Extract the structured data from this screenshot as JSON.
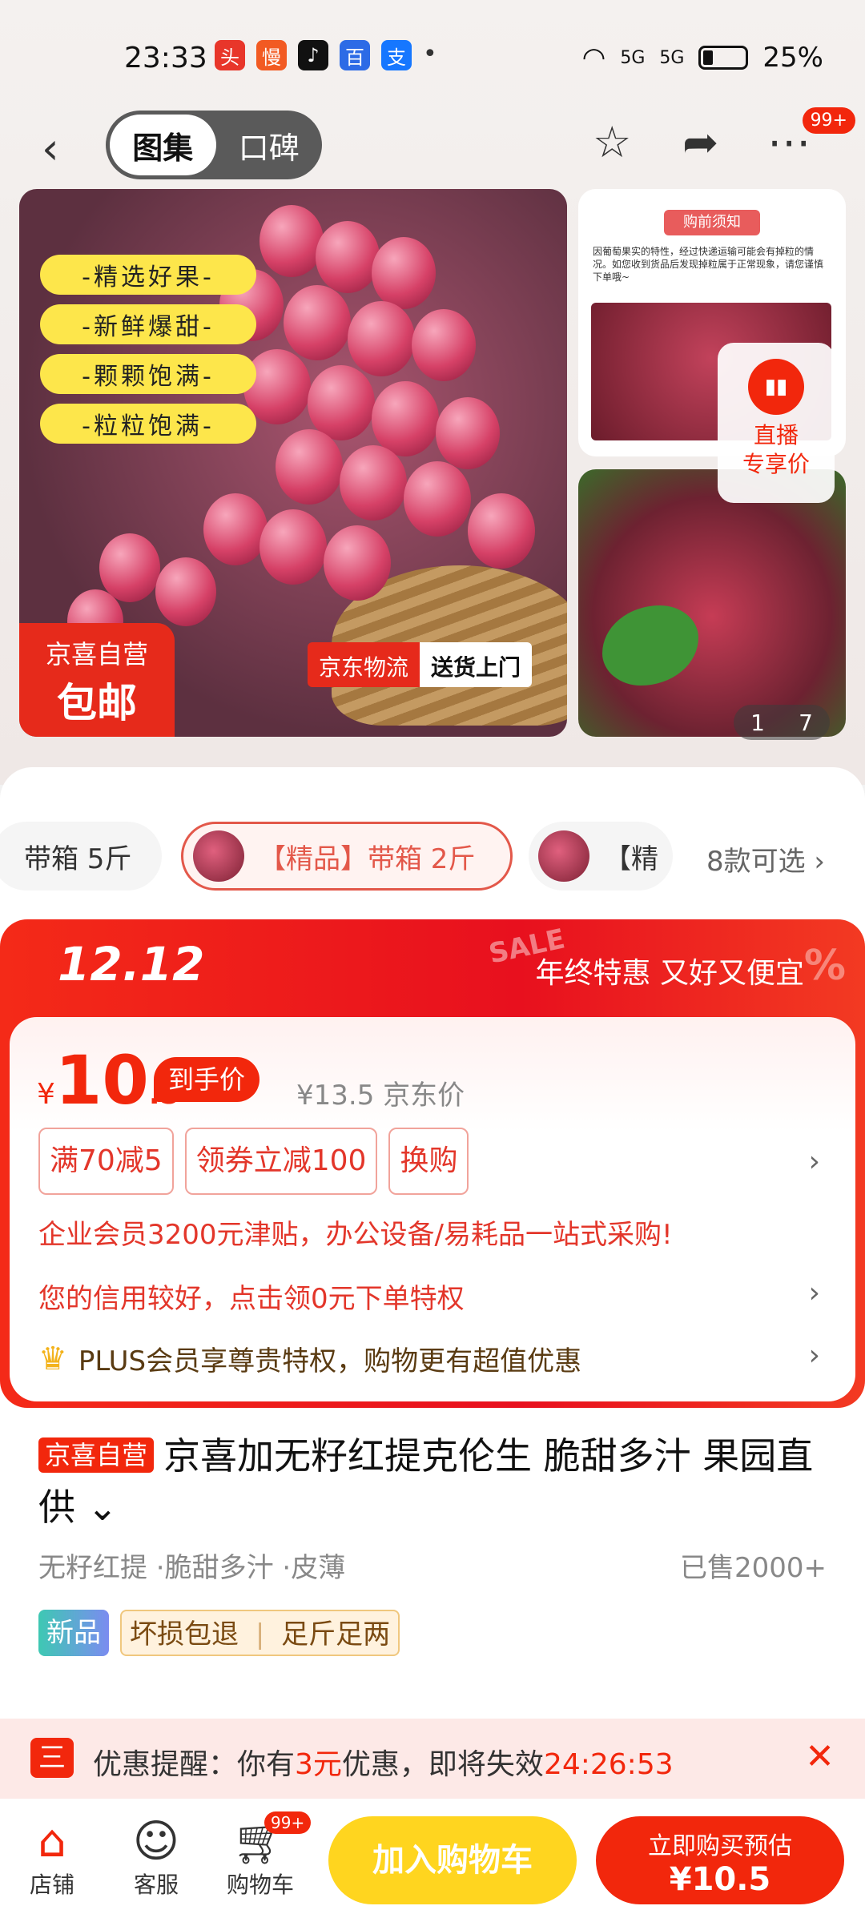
{
  "status": {
    "time": "23:33",
    "battery": "25%",
    "apps": [
      "头",
      "慢",
      "♪",
      "百",
      "支"
    ],
    "net1": "5G",
    "net2": "5G"
  },
  "nav": {
    "tab_gallery": "图集",
    "tab_reviews": "口碑",
    "badge": "99+"
  },
  "gallery": {
    "tags": [
      "-精选好果-",
      "-新鲜爆甜-",
      "-颗颗饱满-",
      "-粒粒饱满-"
    ],
    "self_op_line1": "京喜自营",
    "self_op_line2": "包邮",
    "logistics_a": "京东物流",
    "logistics_b": "送货上门",
    "notice_title": "购前须知",
    "notice_text": "因葡萄果实的特性，经过快递运输可能会有掉粒的情况。如您收到货品后发现掉粒属于正常现象，请您谨慎下单哦~",
    "live_line1": "直播",
    "live_line2": "专享价",
    "counter_current": "1",
    "counter_total": "7"
  },
  "specs": {
    "item1": "带箱 5斤",
    "item2": "【精品】带箱 2斤",
    "item3": "【精",
    "more": "8款可选 ›"
  },
  "promo": {
    "event": "12.12",
    "slogan": "年终特惠 又好又便宜",
    "sale": "SALE",
    "pct": "%",
    "currency": "¥",
    "price_int": "10",
    "price_dec": ".5",
    "price_tag": "到手价",
    "orig_price": "¥13.5 京东价",
    "coupons": [
      "满70减5",
      "领券立减100",
      "换购"
    ],
    "enterprise": "企业会员3200元津贴，办公设备/易耗品一站式采购!",
    "credit": "您的信用较好，点击领0元下单特权",
    "plus": "PLUS会员享尊贵特权，购物更有超值优惠"
  },
  "product": {
    "badge": "京喜自营",
    "title": "京喜加无籽红提克伦生 脆甜多汁 果园直供",
    "meta": "无籽红提 ·脆甜多汁 ·皮薄",
    "sold": "已售2000+",
    "tag_new": "新品",
    "tag_ship1": "坏损包退",
    "tag_ship2": "足斤足两"
  },
  "reminder": {
    "prefix": "优惠提醒：你有",
    "amount": "3元",
    "suffix": "优惠，即将失效",
    "countdown": "24:26:53"
  },
  "bottom": {
    "shop": "店铺",
    "service": "客服",
    "cart": "购物车",
    "cart_badge": "99+",
    "add_cart": "加入购物车",
    "buy_line1": "立即购买预估",
    "buy_line2": "¥10.5"
  },
  "colors": {
    "accent": "#f2270c",
    "yellow": "#ffd51f"
  }
}
